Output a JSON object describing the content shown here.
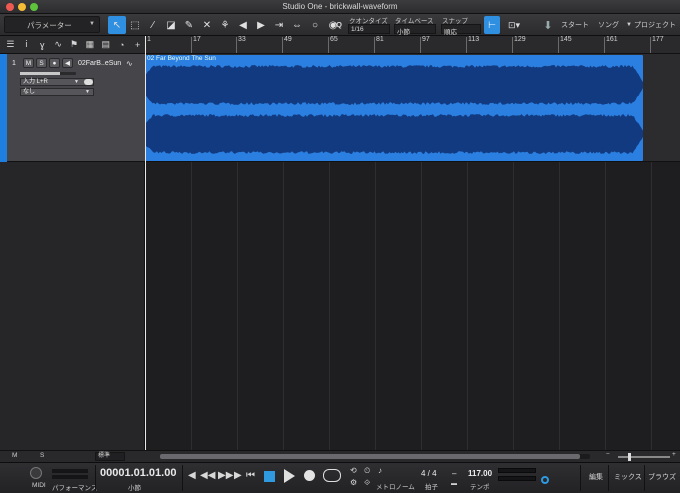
{
  "window": {
    "title": "Studio One - brickwall-waveform"
  },
  "toolbar": {
    "parameter_label": "パラメーター",
    "quantize_label": "クオンタイズ",
    "quantize_value": "1/16",
    "timebase_label": "タイムベース",
    "timebase_value": "小節",
    "snap_label": "スナップ",
    "snap_value": "順応",
    "iq_label": "IQ",
    "start_label": "スタート",
    "song_label": "ソング",
    "project_label": "プロジェクト"
  },
  "ruler": {
    "marks": [
      "1",
      "17",
      "33",
      "49",
      "65",
      "81",
      "97",
      "113",
      "129",
      "145",
      "161",
      "177"
    ]
  },
  "track": {
    "number": "1",
    "mute_label": "M",
    "solo_label": "S",
    "name": "02FarB..eSun",
    "input_label": "入力 L+R",
    "output_label": "なし",
    "fader_level": 0.72,
    "clip_name": "02 Far Beyond The Sun",
    "color": "#2b7fe0"
  },
  "bottom": {
    "m_label": "M",
    "s_label": "S",
    "view_select": "標準"
  },
  "transport": {
    "midi_label": "MIDI",
    "performance_label": "パフォーマンス",
    "time_display": "00001.01.01.00",
    "time_unit": "小節",
    "metronome_label": "メトロノーム",
    "signature_value": "4 / 4",
    "signature_label": "拍子",
    "tempo_value": "117.00",
    "tempo_label": "テンポ",
    "tempo_dash": "–",
    "edit_label": "編集",
    "mix_label": "ミックス",
    "browse_label": "ブラウズ"
  },
  "colors": {
    "accent": "#2f8fe0",
    "clip": "#2b7fe0",
    "waveform": "#123a80"
  }
}
